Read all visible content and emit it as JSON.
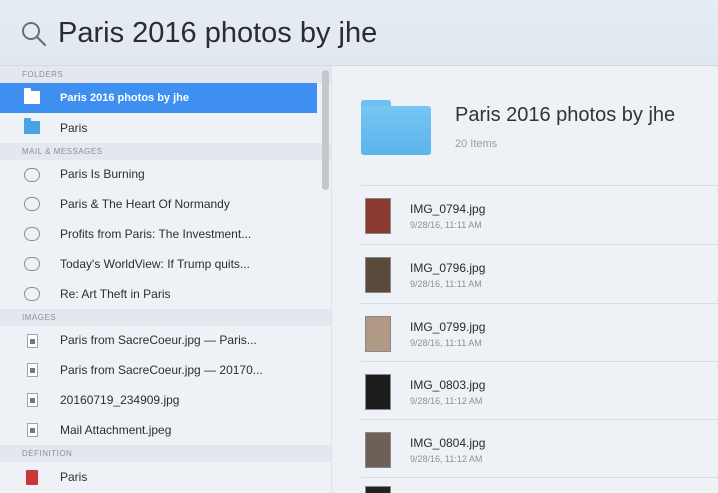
{
  "search": {
    "query": "Paris 2016 photos by jhe",
    "icon": "search-icon"
  },
  "sections": {
    "folders": "FOLDERS",
    "mail": "MAIL & MESSAGES",
    "images": "IMAGES",
    "definition": "DEFINITION"
  },
  "folders": [
    {
      "label": "Paris 2016 photos by jhe",
      "icon": "folder-icon"
    },
    {
      "label": "Paris",
      "icon": "folder-icon"
    }
  ],
  "mail": [
    {
      "label": "Paris Is Burning",
      "icon": "mail-icon"
    },
    {
      "label": "Paris & The Heart Of Normandy",
      "icon": "mail-icon"
    },
    {
      "label": "Profits from Paris: The Investment...",
      "icon": "mail-icon"
    },
    {
      "label": "Today's WorldView: If Trump quits...",
      "icon": "mail-icon"
    },
    {
      "label": "Re: Art Theft in Paris",
      "icon": "mail-icon"
    }
  ],
  "images": [
    {
      "label": "Paris from SacreCoeur.jpg  — Paris...",
      "icon": "image-file-icon"
    },
    {
      "label": "Paris from SacreCoeur.jpg  — 20170...",
      "icon": "image-file-icon"
    },
    {
      "label": "20160719_234909.jpg",
      "icon": "image-file-icon"
    },
    {
      "label": "Mail Attachment.jpeg",
      "icon": "image-file-icon"
    }
  ],
  "definition": [
    {
      "label": "Paris",
      "icon": "dictionary-icon"
    }
  ],
  "preview": {
    "title": "Paris 2016 photos by jhe",
    "subtitle": "20 Items",
    "files": [
      {
        "name": "IMG_0794.jpg",
        "date": "9/28/16, 11:11 AM",
        "thumb_color": "#8a3a2e"
      },
      {
        "name": "IMG_0796.jpg",
        "date": "9/28/16, 11:11 AM",
        "thumb_color": "#5a4a3c"
      },
      {
        "name": "IMG_0799.jpg",
        "date": "9/28/16, 11:11 AM",
        "thumb_color": "#b09a86"
      },
      {
        "name": "IMG_0803.jpg",
        "date": "9/28/16, 11:12 AM",
        "thumb_color": "#1c1c1c"
      },
      {
        "name": "IMG_0804.jpg",
        "date": "9/28/16, 11:12 AM",
        "thumb_color": "#6c6058"
      }
    ]
  },
  "colors": {
    "selection": "#3f8ff0",
    "folder": "#49a4e6"
  }
}
